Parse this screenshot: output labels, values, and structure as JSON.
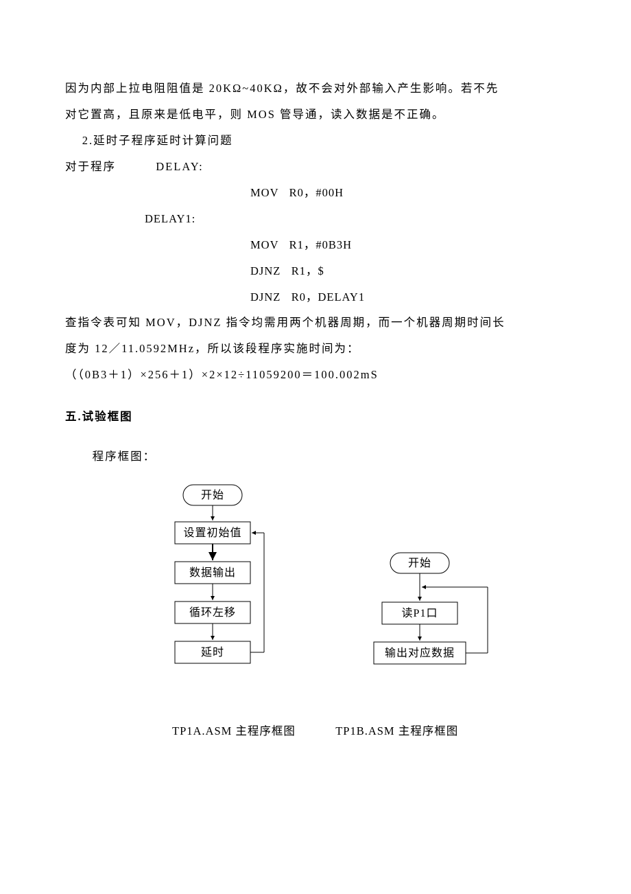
{
  "paras": {
    "l1": "因为内部上拉电阻阻值是 20KΩ~40KΩ，故不会对外部输入产生影响。若不先",
    "l2": "对它置高，且原来是低电平，则 MOS 管导通，读入数据是不正确。",
    "l3": "2.延时子程序延时计算问题",
    "l4a": "对于程序",
    "l4b": "DELAY:",
    "c1": "MOV   R0，#00H",
    "l5": "DELAY1:",
    "c2": "MOV   R1，#0B3H",
    "c3": "DJNZ   R1，$",
    "c4": "DJNZ   R0，DELAY1",
    "l6": "查指令表可知 MOV，DJNZ 指令均需用两个机器周期，而一个机器周期时间长",
    "l7": "度为 12／11.0592MHz，所以该段程序实施时间为：",
    "l8": "（（0B3＋1）×256＋1）×2×12÷11059200＝100.002mS"
  },
  "h5": "五.试验框图",
  "pgk": "程序框图：",
  "flowA": {
    "n1": "开始",
    "n2": "设置初始值",
    "n3": "数据输出",
    "n4": "循环左移",
    "n5": "延时"
  },
  "flowB": {
    "n1": "开始",
    "n2": "读P1口",
    "n3": "输出对应数据"
  },
  "cap1": "TP1A.ASM 主程序框图",
  "cap2": "TP1B.ASM 主程序框图"
}
